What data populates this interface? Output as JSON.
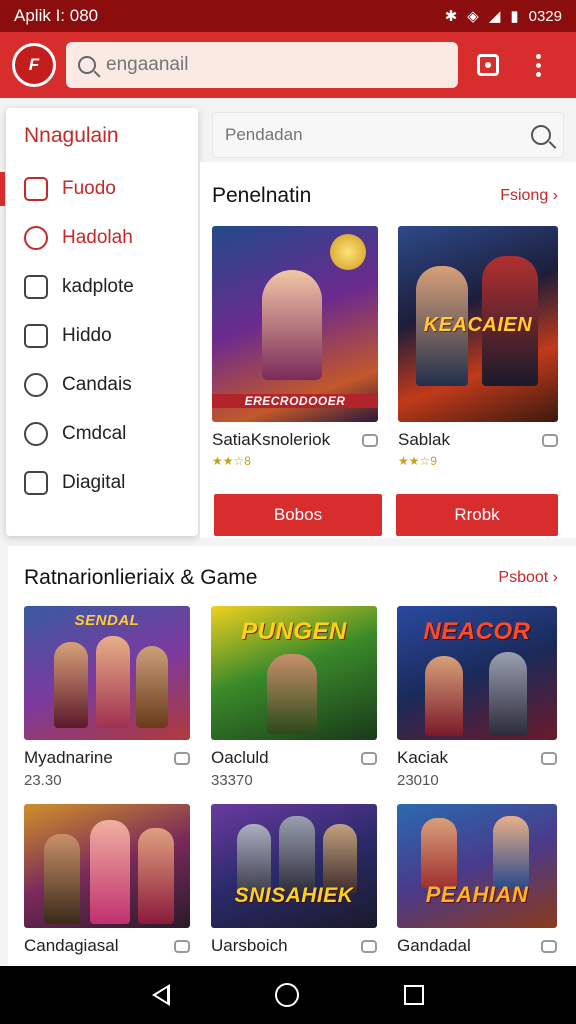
{
  "status": {
    "left": "Aplik I: 080",
    "time": "0329"
  },
  "appbar": {
    "search_placeholder": "engaanail"
  },
  "drawer": {
    "title": "Nnagulain",
    "items": [
      {
        "label": "Fuodo"
      },
      {
        "label": "Hadolah"
      },
      {
        "label": "kadplote"
      },
      {
        "label": "Hiddo"
      },
      {
        "label": "Candais"
      },
      {
        "label": "Cmdcal"
      },
      {
        "label": "Diagital"
      }
    ]
  },
  "search2": {
    "placeholder": "Pendadan"
  },
  "featured": {
    "title": "Penelnatin",
    "link": "Fsiong ›",
    "cards": [
      {
        "name": "SatiaKsnoleriok",
        "rating": "★★☆8",
        "art": "ERECRODOOER"
      },
      {
        "name": "Sablak",
        "rating": "★★☆9",
        "art": "KEACAIEN"
      }
    ],
    "buttons": [
      "Bobos",
      "Rrobk"
    ]
  },
  "popular": {
    "title": "Ratnarionlieriaix & Game",
    "link": "Psboot ›",
    "cards": [
      {
        "name": "Myadnarine",
        "price": "23.30",
        "art": "SENDAL"
      },
      {
        "name": "Oacluld",
        "price": "33370",
        "art": "PUNGEN"
      },
      {
        "name": "Kaciak",
        "price": "23010",
        "art": "NEACOR"
      },
      {
        "name": "Candagiasal",
        "price": "",
        "art": ""
      },
      {
        "name": "Uarsboich",
        "price": "",
        "art": "SNISAHIEK"
      },
      {
        "name": "Gandadal",
        "price": "",
        "art": "PEAHIAN"
      }
    ]
  },
  "colors": {
    "primary": "#d72d2d",
    "status": "#8c0d0d",
    "accent_text": "#c62828"
  }
}
